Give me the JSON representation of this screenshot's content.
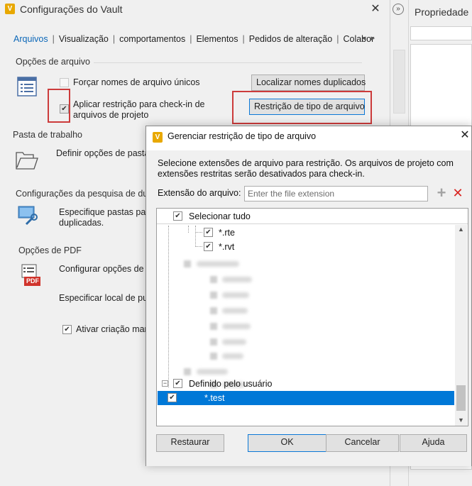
{
  "settings_window": {
    "title": "Configurações do Vault",
    "close": "✕",
    "tabs": [
      {
        "label": "Arquivos",
        "active": true
      },
      {
        "label": "Visualização",
        "active": false
      },
      {
        "label": "comportamentos",
        "active": false
      },
      {
        "label": "Elementos",
        "active": false
      },
      {
        "label": "Pedidos de alteração",
        "active": false
      },
      {
        "label": "Colabor",
        "active": false
      }
    ],
    "tab_separator": "|",
    "tab_arrows": "◂ ▸",
    "file_options": {
      "heading": "Opções de arquivo",
      "force_unique": {
        "label": "Forçar nomes de arquivo únicos",
        "checked": false,
        "enabled": false
      },
      "apply_restriction": {
        "label_line1": "Aplicar restrição para check-in de",
        "label_line2": "arquivos de projeto",
        "checked": true
      },
      "find_duplicates_button": "Localizar nomes duplicados",
      "restriction_button": "Restrição de tipo de arquivo"
    },
    "workspace": {
      "heading": "Pasta de trabalho",
      "define_label": "Definir opções de pasta"
    },
    "duplicate_search": {
      "heading": "Configurações da pesquisa de dupl",
      "line1": "Especifique pastas para",
      "line2": "duplicadas."
    },
    "pdf_options": {
      "heading": "Opções de PDF",
      "configure_label": "Configurar opções de p",
      "publish_label": "Especificar local de pub",
      "activate": {
        "label": "Ativar criação man",
        "checked": true
      },
      "pdf_icon_text": "PDF"
    }
  },
  "properties_panel": {
    "title": "Propriedade",
    "collapse_icon": "»"
  },
  "dialog": {
    "title": "Gerenciar restrição de tipo de arquivo",
    "close": "✕",
    "description": "Selecione extensões de arquivo para restrição. Os arquivos de projeto com extensões restritas serão desativados para check-in.",
    "extension_label": "Extensão do arquivo:",
    "extension_placeholder": "Enter the file extension",
    "extension_value": "",
    "add_icon": "+",
    "remove_icon": "✕",
    "tree": {
      "select_all": {
        "label": "Selecionar tudo",
        "checked": true
      },
      "items_visible": [
        {
          "label": "*.rte",
          "checked": true
        },
        {
          "label": "*.rvt",
          "checked": true
        }
      ],
      "user_defined": {
        "label": "Definido pelo usuário",
        "checked": true,
        "expander": "−"
      },
      "user_items": [
        {
          "label": "*.test",
          "checked": true,
          "selected": true
        }
      ]
    },
    "buttons": {
      "restore": "Restaurar",
      "ok": "OK",
      "cancel": "Cancelar",
      "help": "Ajuda"
    }
  },
  "colors": {
    "accent": "#0078d7",
    "highlight_box": "#cc3b3b",
    "active_tab": "#0b67b8"
  }
}
